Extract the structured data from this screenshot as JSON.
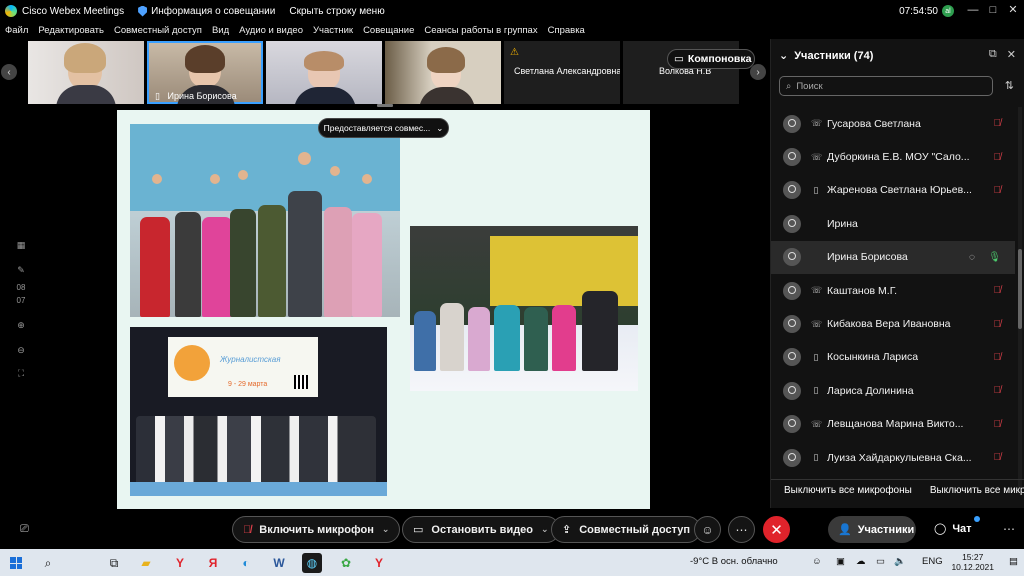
{
  "window": {
    "app_title": "Cisco Webex Meetings",
    "meeting_info": "Информация о совещании",
    "hide_menu": "Скрыть строку меню",
    "time": "07:54:50",
    "avatar_initial": "al"
  },
  "menu": [
    "Файл",
    "Редактировать",
    "Совместный доступ",
    "Вид",
    "Аудио и видео",
    "Участник",
    "Совещание",
    "Сеансы работы в группах",
    "Справка"
  ],
  "thumbnails": [
    {
      "name": ""
    },
    {
      "name": "Ирина Борисова"
    },
    {
      "name": ""
    },
    {
      "name": ""
    },
    {
      "name": "Светлана Александровна ..."
    },
    {
      "name": "Волкова Н.В"
    }
  ],
  "layout_button": "Компоновка",
  "sharing_pill": "Предоставляется совмес...",
  "slide": {
    "banner_title": "Журналистская",
    "banner_date": "9 - 29 марта"
  },
  "left_tools": [
    "08",
    "07"
  ],
  "participants": {
    "title": "Участники (74)",
    "search_placeholder": "Поиск",
    "list": [
      {
        "name": "Гусарова Светлана",
        "type": "☏",
        "mic": "muted"
      },
      {
        "name": "Дуборкина Е.В. МОУ \"Сало...",
        "type": "☏",
        "mic": "muted"
      },
      {
        "name": "Жаренова Светлана Юрьев...",
        "type": "▯",
        "mic": "muted"
      },
      {
        "name": "Ирина",
        "type": "",
        "mic": "none"
      },
      {
        "name": "Ирина Борисова",
        "type": "",
        "mic": "on",
        "highlight": true
      },
      {
        "name": "Каштанов М.Г.",
        "type": "☏",
        "mic": "muted"
      },
      {
        "name": "Кибакова Вера Ивановна",
        "type": "☏",
        "mic": "muted"
      },
      {
        "name": "Косынкина Лариса",
        "type": "▯",
        "mic": "muted"
      },
      {
        "name": "Лариса Долинина",
        "type": "▯",
        "mic": "muted"
      },
      {
        "name": "Левщанова Марина Викто...",
        "type": "☏",
        "mic": "muted"
      },
      {
        "name": "Луиза Хайдаркулыевна Ска...",
        "type": "▯",
        "mic": "muted"
      }
    ],
    "mute_all_1": "Выключить все микрофоны",
    "mute_all_2": "Выключить все микрофо"
  },
  "controls": {
    "unmute": "Включить микрофон",
    "stop_video": "Остановить видео",
    "share": "Совместный доступ",
    "participants": "Участники",
    "chat": "Чат"
  },
  "taskbar": {
    "weather": "-9°C  В осн. облачно",
    "lang": "ENG",
    "time": "15:27",
    "date": "10.12.2021"
  },
  "colors": {
    "accent": "#3aa0ff",
    "end_call": "#e0232b",
    "mic_muted": "#e0404a",
    "mic_on": "#4ccd6e",
    "slide_bg": "#e9f6f2"
  }
}
